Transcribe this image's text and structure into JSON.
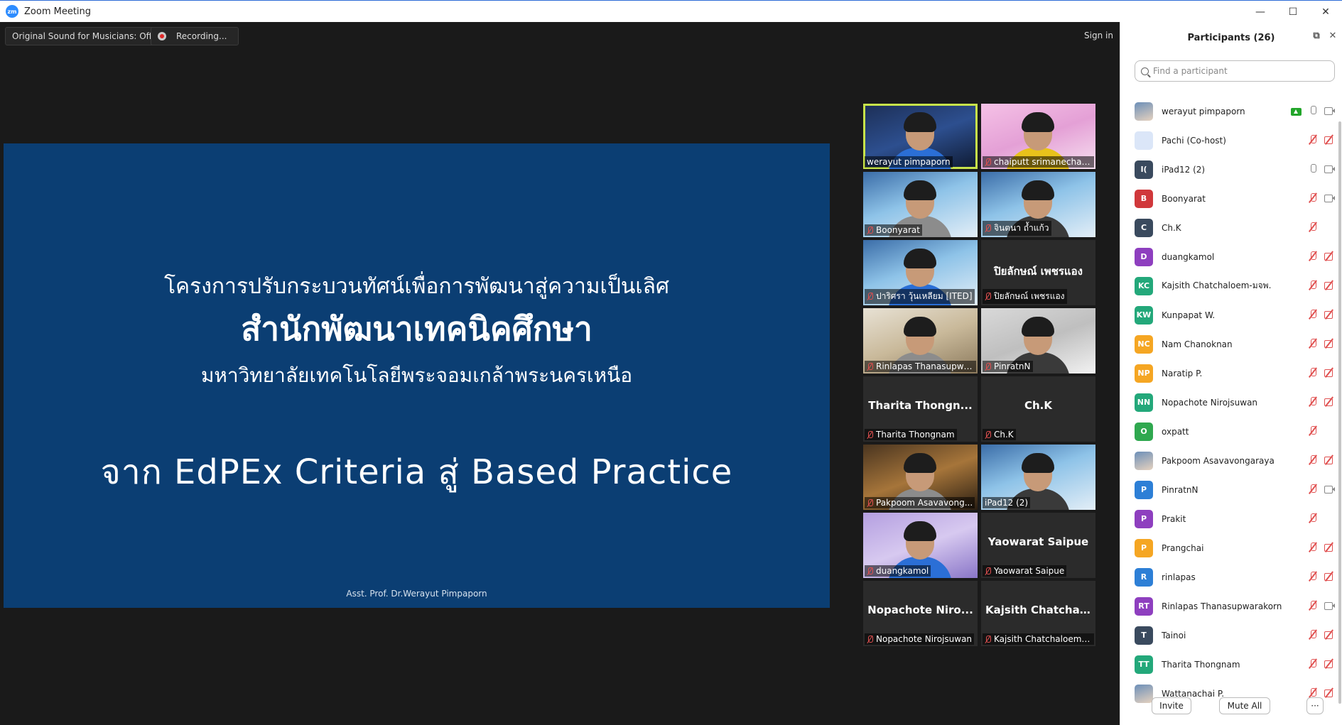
{
  "window": {
    "title": "Zoom Meeting",
    "app_logo_text": "zm",
    "controls": [
      "—",
      "☐",
      "✕"
    ]
  },
  "toolbar": {
    "original_sound": "Original Sound for Musicians: Off",
    "recording": "Recording...",
    "sign_in": "Sign in"
  },
  "slide": {
    "line1": "โครงการปรับกระบวนทัศน์เพื่อการพัฒนาสู่ความเป็นเลิศ",
    "line2": "สำนักพัฒนาเทคนิคศึกษา",
    "line3": "มหาวิทยาลัยเทคโนโลยีพระจอมเกล้าพระนครเหนือ",
    "line4": "จาก EdPEx Criteria สู่ Based Practice",
    "footer": "Asst. Prof. Dr.Werayut Pimpaporn"
  },
  "gallery": [
    {
      "label": "werayut pimpaporn",
      "muted": false,
      "video": "dark",
      "active": true
    },
    {
      "label": "chaiputt srimanechai...",
      "muted": true,
      "video": "pink"
    },
    {
      "label": "Boonyarat",
      "muted": true,
      "video": "video"
    },
    {
      "label": "จินตนา ถ้ำแก้ว",
      "muted": true,
      "video": "video"
    },
    {
      "label": "ปาริศรา วุ้นเหลียม [ITED]",
      "muted": true,
      "video": "video"
    },
    {
      "label": "ปิยลักษณ์ เพชรแอง",
      "muted": true,
      "center": "ปิยลักษณ์ เพชรแอง"
    },
    {
      "label": "Rinlapas Thanasupwa...",
      "muted": true,
      "video": "room"
    },
    {
      "label": "PinratnN",
      "muted": true,
      "video": "gray"
    },
    {
      "label": "Tharita Thongnam",
      "muted": true,
      "center": "Tharita Thongn..."
    },
    {
      "label": "Ch.K",
      "muted": true,
      "center": "Ch.K"
    },
    {
      "label": "Pakpoom Asavavong...",
      "muted": true,
      "video": "warm"
    },
    {
      "label": "iPad12 (2)",
      "muted": false,
      "video": "video"
    },
    {
      "label": "duangkamol",
      "muted": true,
      "video": "purple"
    },
    {
      "label": "Yaowarat Saipue",
      "muted": true,
      "center": "Yaowarat Saipue"
    },
    {
      "label": "Nopachote Nirojsuwan",
      "muted": true,
      "center": "Nopachote Niro..."
    },
    {
      "label": "Kajsith Chatchaloem-...",
      "muted": true,
      "center": "Kajsith Chatchal..."
    }
  ],
  "panel": {
    "title": "Participants (26)",
    "search_placeholder": "Find a participant",
    "invite": "Invite",
    "mute_all": "Mute All",
    "more": "···"
  },
  "participants": [
    {
      "name": "werayut pimpaporn",
      "initials": "",
      "color": "",
      "photo": true,
      "share": true,
      "mic": "on",
      "cam": "on"
    },
    {
      "name": "Pachi (Co-host)",
      "initials": "",
      "color": "",
      "light": true,
      "mic": "off",
      "cam": "off"
    },
    {
      "name": "iPad12 (2)",
      "initials": "I(",
      "color": "#3a4a5e",
      "mic": "on",
      "cam": "on"
    },
    {
      "name": "Boonyarat",
      "initials": "B",
      "color": "#d0383b",
      "mic": "off",
      "cam": "on"
    },
    {
      "name": "Ch.K",
      "initials": "C",
      "color": "#3a4a5e",
      "mic": "off",
      "cam": "none"
    },
    {
      "name": "duangkamol",
      "initials": "D",
      "color": "#8e3fbf",
      "mic": "off",
      "cam": "off"
    },
    {
      "name": "Kajsith Chatchaloem-มจพ.",
      "initials": "KC",
      "color": "#23a87a",
      "mic": "off",
      "cam": "off"
    },
    {
      "name": "Kunpapat W.",
      "initials": "KW",
      "color": "#23a87a",
      "mic": "off",
      "cam": "off"
    },
    {
      "name": "Nam Chanoknan",
      "initials": "NC",
      "color": "#f5a623",
      "mic": "off",
      "cam": "off"
    },
    {
      "name": "Naratip P.",
      "initials": "NP",
      "color": "#f5a623",
      "mic": "off",
      "cam": "off"
    },
    {
      "name": "Nopachote Nirojsuwan",
      "initials": "NN",
      "color": "#23a87a",
      "mic": "off",
      "cam": "off"
    },
    {
      "name": "oxpatt",
      "initials": "O",
      "color": "#2fa84f",
      "mic": "off",
      "cam": "none"
    },
    {
      "name": "Pakpoom Asavavongaraya",
      "initials": "",
      "color": "",
      "photo": true,
      "mic": "off",
      "cam": "off"
    },
    {
      "name": "PinratnN",
      "initials": "P",
      "color": "#2d7fd6",
      "mic": "off",
      "cam": "on"
    },
    {
      "name": "Prakit",
      "initials": "P",
      "color": "#8e3fbf",
      "mic": "off",
      "cam": "none"
    },
    {
      "name": "Prangchai",
      "initials": "P",
      "color": "#f5a623",
      "mic": "off",
      "cam": "off"
    },
    {
      "name": "rinlapas",
      "initials": "R",
      "color": "#2d7fd6",
      "mic": "off",
      "cam": "off"
    },
    {
      "name": "Rinlapas Thanasupwarakorn",
      "initials": "RT",
      "color": "#8e3fbf",
      "mic": "off",
      "cam": "on"
    },
    {
      "name": "Tainoi",
      "initials": "T",
      "color": "#3a4a5e",
      "mic": "off",
      "cam": "off"
    },
    {
      "name": "Tharita Thongnam",
      "initials": "TT",
      "color": "#23a87a",
      "mic": "off",
      "cam": "off"
    },
    {
      "name": "Wattanachai P.",
      "initials": "",
      "color": "",
      "photo": true,
      "mic": "off",
      "cam": "off"
    }
  ]
}
